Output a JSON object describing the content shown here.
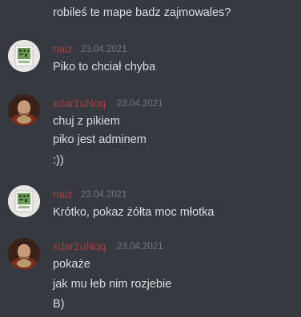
{
  "messages": [
    {
      "continued_top": true,
      "lines": [
        "robileś te mape badz zajmowales?"
      ]
    },
    {
      "author": "naiz",
      "author_color": "#a83d3d",
      "avatar": "naiz-avatar",
      "timestamp": "23.04.2021",
      "lines": [
        "Piko to chciał chyba"
      ]
    },
    {
      "author": "xdar1uNqq",
      "author_color": "#a83d3d",
      "avatar": "xdar1unqq-avatar",
      "timestamp": "23.04.2021",
      "lines": [
        "chuj z pikiem",
        "piko jest adminem",
        ":))"
      ]
    },
    {
      "author": "naiz",
      "author_color": "#a83d3d",
      "avatar": "naiz-avatar",
      "timestamp": "23.04.2021",
      "lines": [
        "Krótko, pokaz żółta moc młotka"
      ]
    },
    {
      "author": "xdar1uNqq",
      "author_color": "#a83d3d",
      "avatar": "xdar1unqq-avatar",
      "timestamp": "23.04.2021",
      "lines": [
        "pokaże",
        "jak mu łeb nim rozjebie",
        "B)"
      ]
    }
  ]
}
